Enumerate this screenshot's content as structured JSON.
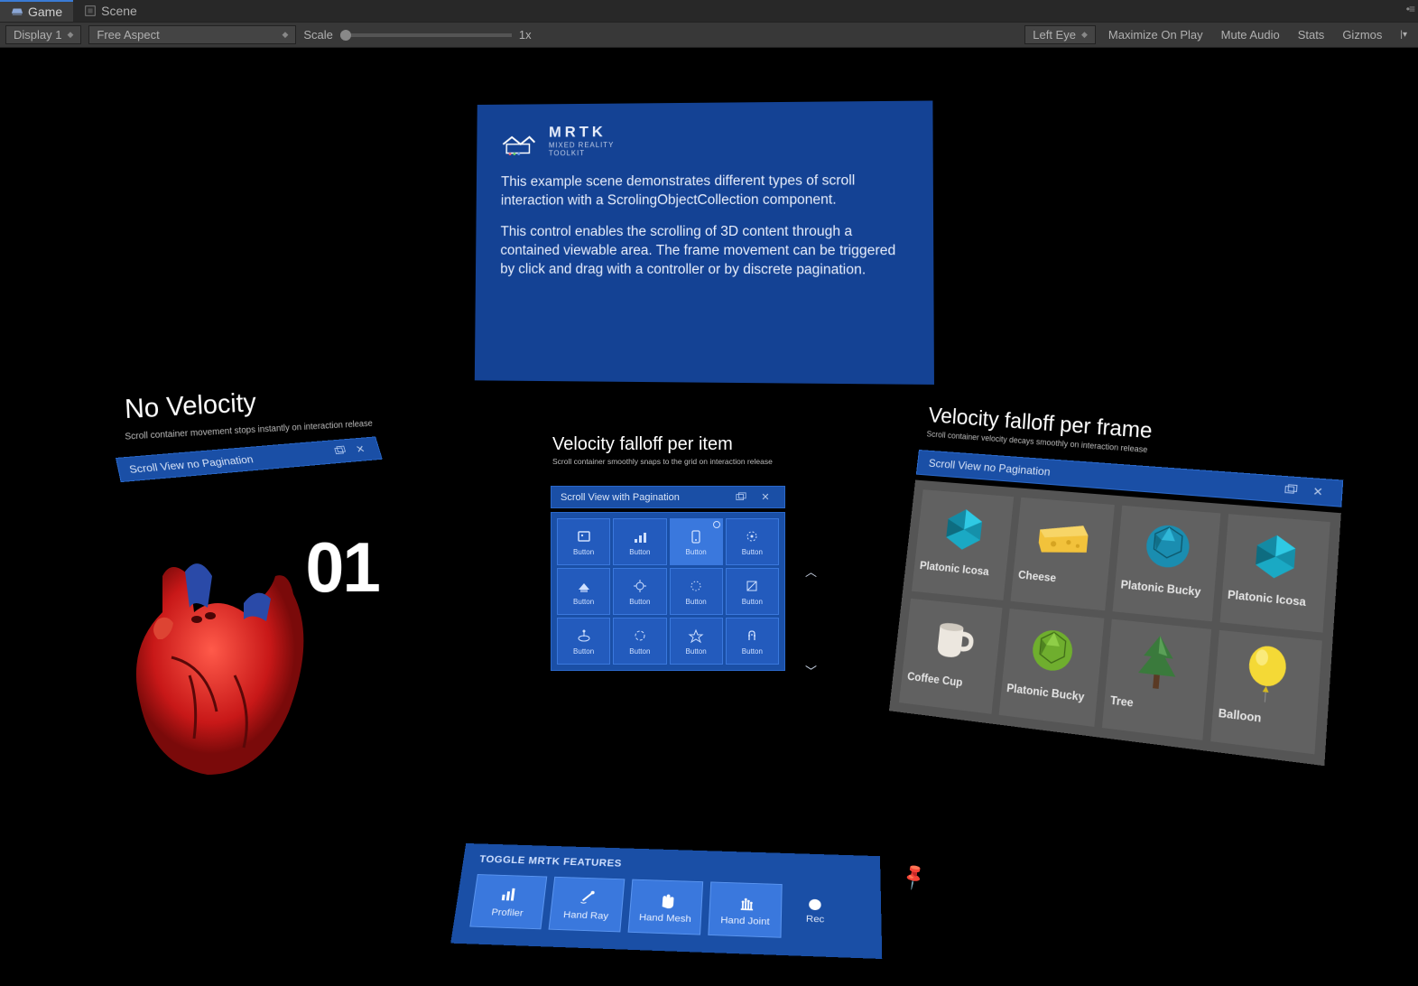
{
  "editor": {
    "tabs": [
      "Game",
      "Scene"
    ],
    "active_tab": "Game",
    "display": "Display 1",
    "aspect": "Free Aspect",
    "scale_label": "Scale",
    "scale_value": "1x",
    "eye": "Left Eye",
    "buttons": [
      "Maximize On Play",
      "Mute Audio",
      "Stats",
      "Gizmos"
    ]
  },
  "info": {
    "logo_title": "MRTK",
    "logo_sub1": "MIXED REALITY",
    "logo_sub2": "TOOLKIT",
    "p1": "This example scene demonstrates different types of scroll interaction with a ScrolingObjectCollection component.",
    "p2": "This control enables the scrolling of 3D content through a contained viewable area. The frame movement can be triggered by click and drag with a controller or by discrete pagination."
  },
  "left": {
    "heading": "No Velocity",
    "sub": "Scroll container movement stops instantly on interaction release",
    "title": "Scroll View no Pagination",
    "number": "01"
  },
  "mid": {
    "heading": "Velocity falloff per item",
    "sub": "Scroll container smoothly snaps to the grid on interaction release",
    "title": "Scroll View with Pagination",
    "cells": [
      "Button",
      "Button",
      "Button",
      "Button",
      "Button",
      "Button",
      "Button",
      "Button",
      "Button",
      "Button",
      "Button",
      "Button"
    ]
  },
  "right": {
    "heading": "Velocity falloff per frame",
    "sub": "Scroll container velocity decays smoothly on interaction release",
    "title": "Scroll View no Pagination",
    "cards": [
      {
        "label": "Platonic Icosa",
        "icon": "icosa-teal"
      },
      {
        "label": "Cheese",
        "icon": "cheese"
      },
      {
        "label": "Platonic Bucky",
        "icon": "bucky-teal"
      },
      {
        "label": "Platonic Icosa",
        "icon": "icosa-teal"
      },
      {
        "label": "Coffee Cup",
        "icon": "cup"
      },
      {
        "label": "Platonic Bucky",
        "icon": "bucky-green"
      },
      {
        "label": "Tree",
        "icon": "tree"
      },
      {
        "label": "Balloon",
        "icon": "balloon"
      }
    ]
  },
  "toggle": {
    "header": "TOGGLE MRTK FEATURES",
    "buttons": [
      {
        "label": "Profiler",
        "icon": "bars"
      },
      {
        "label": "Hand Ray",
        "icon": "ray"
      },
      {
        "label": "Hand Mesh",
        "icon": "hand"
      },
      {
        "label": "Hand Joint",
        "icon": "joint"
      }
    ],
    "rec": "Rec"
  }
}
